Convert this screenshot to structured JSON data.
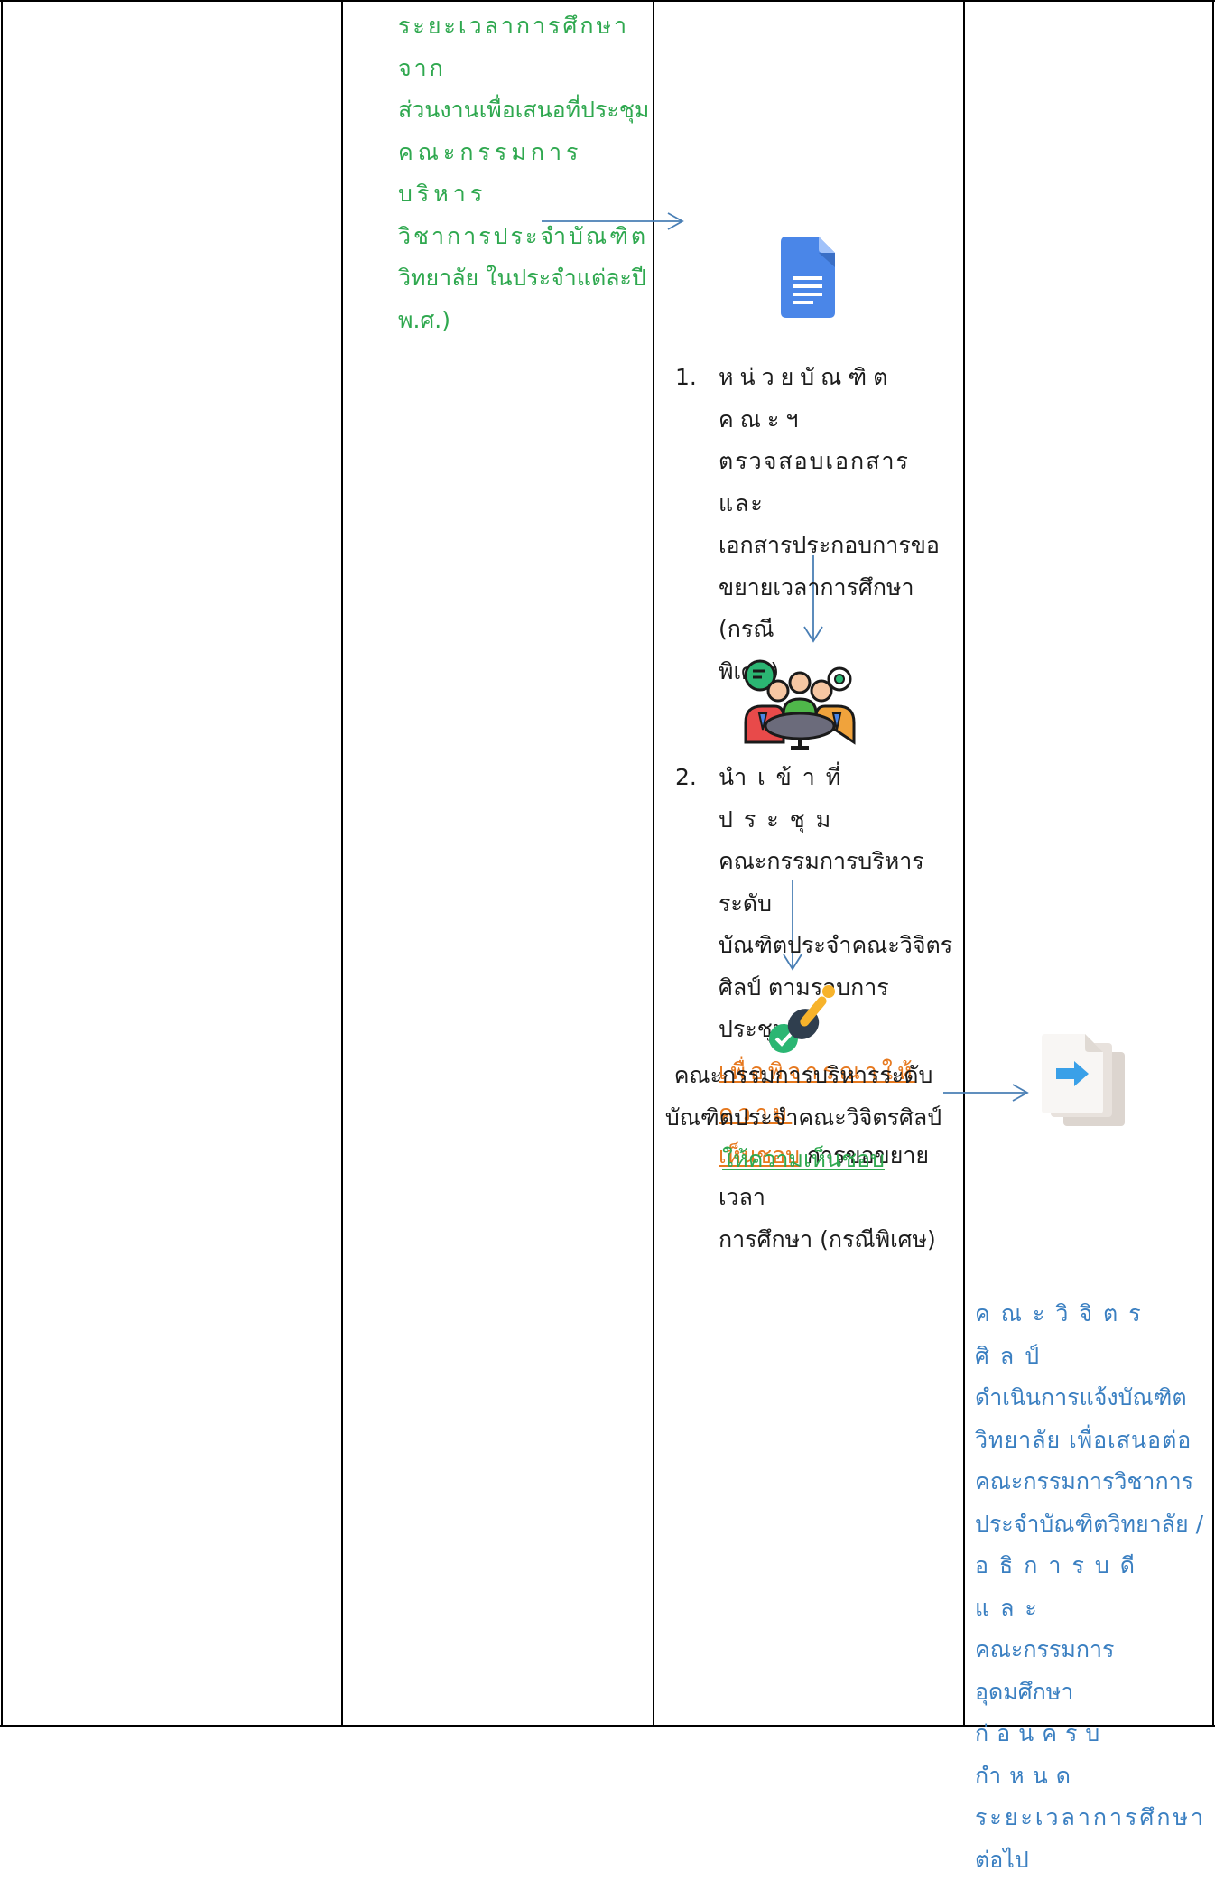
{
  "left_panel": {
    "lines": [
      "ระยะเวลาการศึกษาจาก",
      "ส่วนงานเพื่อเสนอที่ประชุม",
      "คณะกรรมการบริหาร",
      "วิชาการประจำบัณฑิต",
      "วิทยาลัย ในประจำแต่ละปี",
      "พ.ศ.)"
    ]
  },
  "step1": {
    "number": "1.",
    "lines": [
      "หน่วยบัณฑิต คณะฯ",
      "ตรวจสอบเอกสาร และ",
      "เอกสารประกอบการขอ",
      "ขยายเวลาการศึกษา (กรณี",
      "พิเศษ)"
    ]
  },
  "step2": {
    "number": "2.",
    "lines_before": [
      "นำเข้าที่ประชุม",
      "คณะกรรมการบริหารระดับ",
      "บัณฑิตประจำคณะวิจิตร",
      "ศิลป์ ตามรอบการประชุม"
    ],
    "link_line1": "เพื่อพิจารณาให้ความ",
    "link_line2": "เห็นชอบ",
    "after_link": " การขอขยายเวลา",
    "last_line": "การศึกษา (กรณีพิเศษ)"
  },
  "approval": {
    "line1": "คณะกรรมการบริหารระดับ",
    "line2": "บัณฑิตประจำคณะวิจิตรศิลป์",
    "link": "ให้ความเห็นชอบ"
  },
  "right_panel": {
    "lines": [
      "คณะวิจิตรศิลป์",
      "ดำเนินการแจ้งบัณฑิต",
      "วิทยาลัย เพื่อเสนอต่อ",
      "คณะกรรมการวิชาการ",
      "ประจำบัณฑิตวิทยาลัย /",
      "อธิการบดี และ",
      "คณะกรรมการอุดมศึกษา",
      "ก่อนครบกำหนด",
      "ระยะเวลาการศึกษา",
      "ต่อไป"
    ]
  },
  "icons": {
    "document": "google-docs-icon",
    "meeting": "meeting-table-icon",
    "stamp": "approval-stamp-icon",
    "forward": "forward-document-icon"
  },
  "colors": {
    "green": "#2fa84f",
    "blue_text": "#3a7fc1",
    "arrow": "#4a7fb5",
    "link_orange": "#e6781e",
    "border": "#000000"
  }
}
